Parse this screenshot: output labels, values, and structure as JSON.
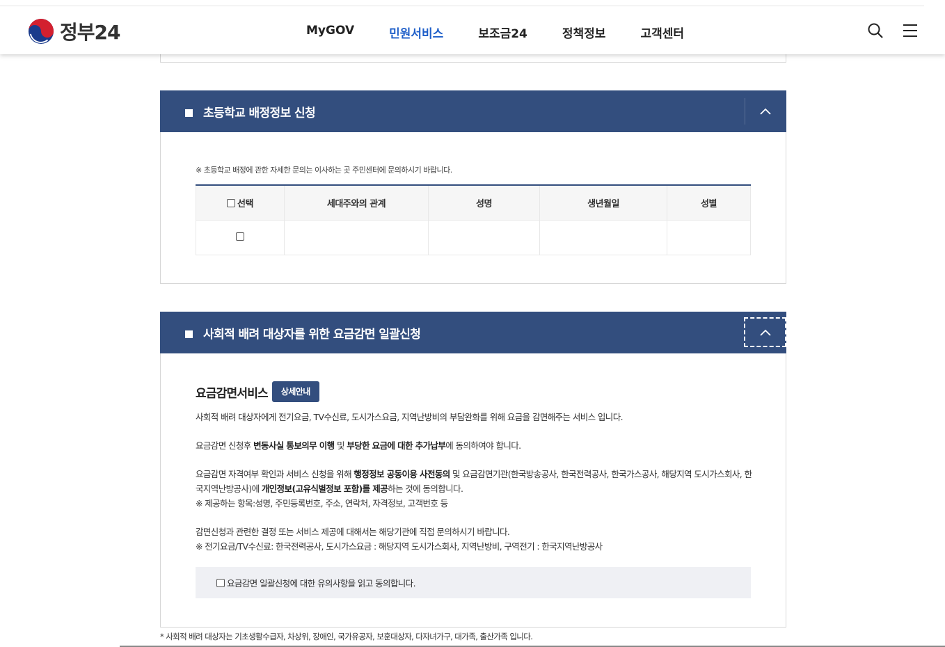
{
  "header": {
    "logo_text": "정부24",
    "nav": [
      "MyGOV",
      "민원서비스",
      "보조금24",
      "정책정보",
      "고객센터"
    ],
    "active_nav": "민원서비스",
    "icons": [
      "search-icon",
      "menu-icon"
    ]
  },
  "section1": {
    "title": "초등학교 배정정보 신청",
    "note": "※ 초등학교 배정에 관한 자세한 문의는 이사하는 곳 주민센터에 문의하시기 바랍니다.",
    "table": {
      "headers": [
        "선택",
        "세대주와의 관계",
        "성명",
        "생년월일",
        "성별"
      ],
      "rows": [
        [
          "",
          "",
          "",
          "",
          ""
        ]
      ]
    }
  },
  "section2": {
    "title": "사회적 배려 대상자를 위한 요금감면 일괄신청",
    "service_title": "요금감면서비스",
    "detail_button": "상세안내",
    "p1": "사회적 배려 대상자에게 전기요금, TV수신료, 도시가스요금, 지역난방비의 부담완화를 위해 요금을 감면해주는 서비스 입니다.",
    "p2_a": "요금감면 신청후 ",
    "p2_b": "변동사실 통보의무 이행",
    "p2_c": " 및 ",
    "p2_d": "부당한 요금에 대한 추가납부",
    "p2_e": "에 동의하여야 합니다.",
    "p3_a": "요금감면 자격여부 확인과 서비스 신청을 위해 ",
    "p3_b": "행정정보 공동이용 사전동의",
    "p3_c": " 및 요금감면기관(한국방송공사, 한국전력공사, 한국가스공사, 해당지역 도시가스회사, 한국지역난방공사)에 ",
    "p3_d": "개인정보(고유식별정보 포함)를 제공",
    "p3_e": "하는 것에 동의합니다.",
    "p3_note": "※ 제공하는 항목:성명, 주민등록번호, 주소, 연락처, 자격정보, 고객번호 등",
    "p4": "감면신청과 관련한 결정 또는 서비스 제공에 대해서는 해당기관에 직접 문의하시기 바랍니다.",
    "p4_note": "※ 전기요금/TV수신료: 한국전력공사, 도시가스요금 : 해당지역 도시가스회사, 지역난방비, 구역전기 : 한국지역난방공사",
    "agree_label": "요금감면 일괄신청에 대한 유의사항을 읽고 동의합니다."
  },
  "footnote": "* 사회적 배려 대상자는 기초생활수급자, 차상위, 장애인, 국가유공자, 보훈대상자, 다자녀가구, 대가족, 출산가족 입니다."
}
